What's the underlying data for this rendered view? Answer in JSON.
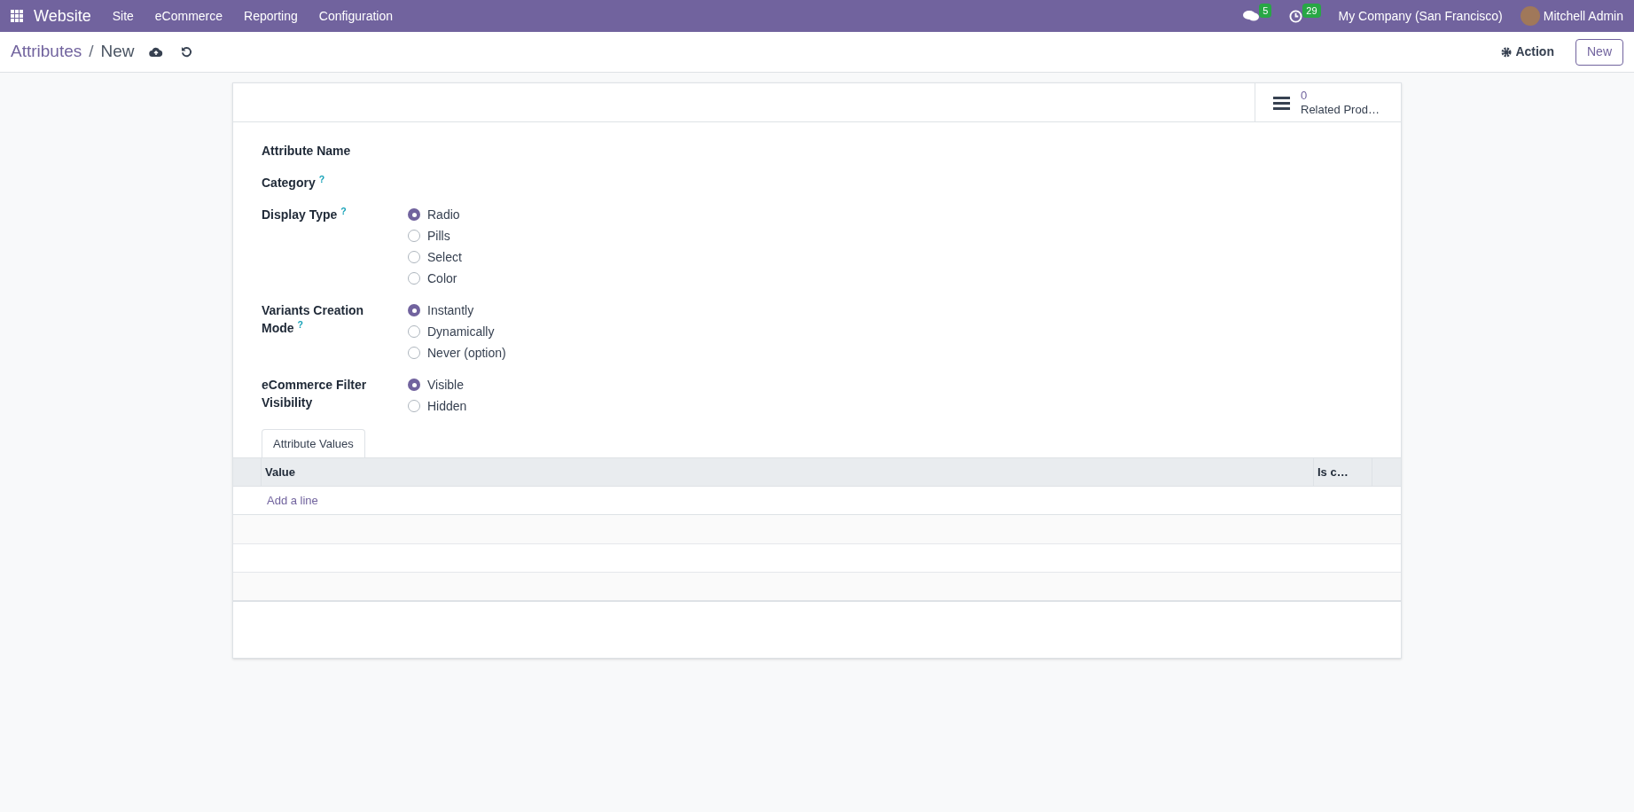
{
  "navbar": {
    "app": "Website",
    "menus": [
      "Site",
      "eCommerce",
      "Reporting",
      "Configuration"
    ],
    "chat_count": "5",
    "activity_count": "29",
    "company": "My Company (San Francisco)",
    "user": "Mitchell Admin"
  },
  "breadcrumb": {
    "parent": "Attributes",
    "separator": "/",
    "current": "New"
  },
  "actions": {
    "action": "Action",
    "new": "New"
  },
  "stat_button": {
    "value": "0",
    "label": "Related Prod…"
  },
  "fields": [
    {
      "label": "Attribute Name",
      "kind": "text"
    },
    {
      "label": "Category",
      "help": "?",
      "kind": "text"
    },
    {
      "label": "Display Type",
      "help": "?",
      "kind": "radio",
      "options": [
        {
          "label": "Radio",
          "selected": true
        },
        {
          "label": "Pills",
          "selected": false
        },
        {
          "label": "Select",
          "selected": false
        },
        {
          "label": "Color",
          "selected": false
        }
      ]
    },
    {
      "label": "Variants Creation Mode",
      "help": "?",
      "kind": "radio",
      "options": [
        {
          "label": "Instantly",
          "selected": true
        },
        {
          "label": "Dynamically",
          "selected": false
        },
        {
          "label": "Never (option)",
          "selected": false
        }
      ]
    },
    {
      "label": "eCommerce Filter Visibility",
      "kind": "radio",
      "options": [
        {
          "label": "Visible",
          "selected": true
        },
        {
          "label": "Hidden",
          "selected": false
        }
      ]
    }
  ],
  "tabs": [
    {
      "label": "Attribute Values",
      "selected": true
    }
  ],
  "table": {
    "columns": [
      "Value",
      "Is c…"
    ],
    "add_line": "Add a line"
  }
}
